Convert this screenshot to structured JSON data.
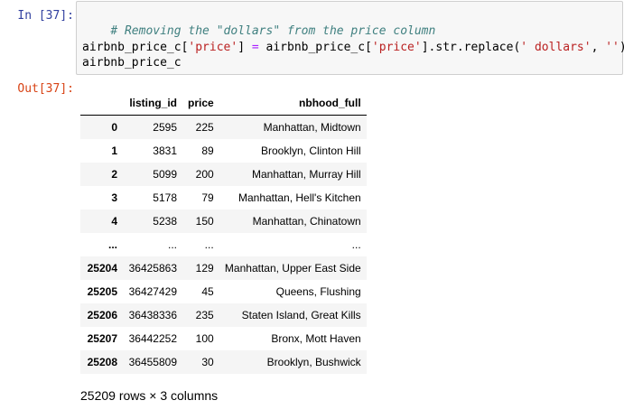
{
  "cell": {
    "in_prompt": "In [37]:",
    "out_prompt": "Out[37]:",
    "code": {
      "comment": "# Removing the \"dollars\" from the price column",
      "line2": [
        {
          "t": "airbnb_price_c[",
          "c": ""
        },
        {
          "t": "'price'",
          "c": "str"
        },
        {
          "t": "] ",
          "c": ""
        },
        {
          "t": "=",
          "c": "op"
        },
        {
          "t": " airbnb_price_c[",
          "c": ""
        },
        {
          "t": "'price'",
          "c": "str"
        },
        {
          "t": "].str.replace(",
          "c": ""
        },
        {
          "t": "' dollars'",
          "c": "str"
        },
        {
          "t": ", ",
          "c": ""
        },
        {
          "t": "''",
          "c": "str"
        },
        {
          "t": ")",
          "c": ""
        }
      ],
      "line3": "airbnb_price_c"
    }
  },
  "table": {
    "columns": [
      "",
      "listing_id",
      "price",
      "nbhood_full"
    ],
    "rows": [
      [
        "0",
        "2595",
        "225",
        "Manhattan, Midtown"
      ],
      [
        "1",
        "3831",
        "89",
        "Brooklyn, Clinton Hill"
      ],
      [
        "2",
        "5099",
        "200",
        "Manhattan, Murray Hill"
      ],
      [
        "3",
        "5178",
        "79",
        "Manhattan, Hell's Kitchen"
      ],
      [
        "4",
        "5238",
        "150",
        "Manhattan, Chinatown"
      ],
      [
        "...",
        "...",
        "...",
        "..."
      ],
      [
        "25204",
        "36425863",
        "129",
        "Manhattan, Upper East Side"
      ],
      [
        "25205",
        "36427429",
        "45",
        "Queens, Flushing"
      ],
      [
        "25206",
        "36438336",
        "235",
        "Staten Island, Great Kills"
      ],
      [
        "25207",
        "36442252",
        "100",
        "Bronx, Mott Haven"
      ],
      [
        "25208",
        "36455809",
        "30",
        "Brooklyn, Bushwick"
      ]
    ],
    "shape": "25209 rows × 3 columns"
  },
  "colors": {
    "in_prompt": "#303F9F",
    "out_prompt": "#D84315",
    "comment": "#408080",
    "string": "#BA2121",
    "operator": "#AA22FF",
    "row_stripe": "#f5f5f5"
  }
}
